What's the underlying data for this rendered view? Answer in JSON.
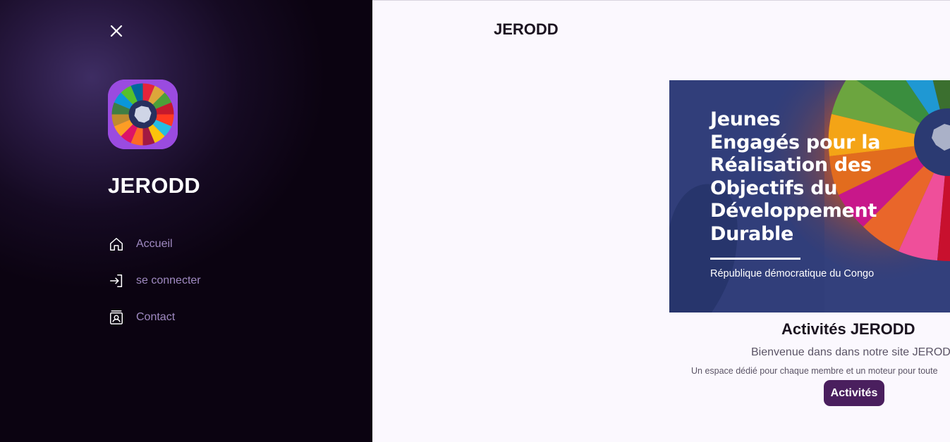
{
  "page": {
    "title": "JERODD"
  },
  "hero": {
    "title_lines": [
      "Jeunes",
      "Engagés pour la",
      "Réalisation des",
      "Objectifs du",
      "Développement",
      "Durable"
    ],
    "subtitle": "République démocratique du Congo"
  },
  "activities": {
    "title": "Activités JERODD",
    "welcome": "Bienvenue dans dans notre site JEROD",
    "description": "Un espace dédié pour chaque membre et un moteur pour toute",
    "button_label": "Activités"
  },
  "drawer": {
    "brand": "JERODD",
    "close_icon": "close-icon",
    "nav": [
      {
        "label": "Accueil",
        "icon": "home-icon"
      },
      {
        "label": "se connecter",
        "icon": "login-icon"
      },
      {
        "label": "Contact",
        "icon": "contact-icon"
      }
    ]
  },
  "colors": {
    "drawer_bg": "#0b0311",
    "accent": "#4a1f5e",
    "nav_text": "#a08ac2",
    "hero_bg": "#2f3c78"
  }
}
